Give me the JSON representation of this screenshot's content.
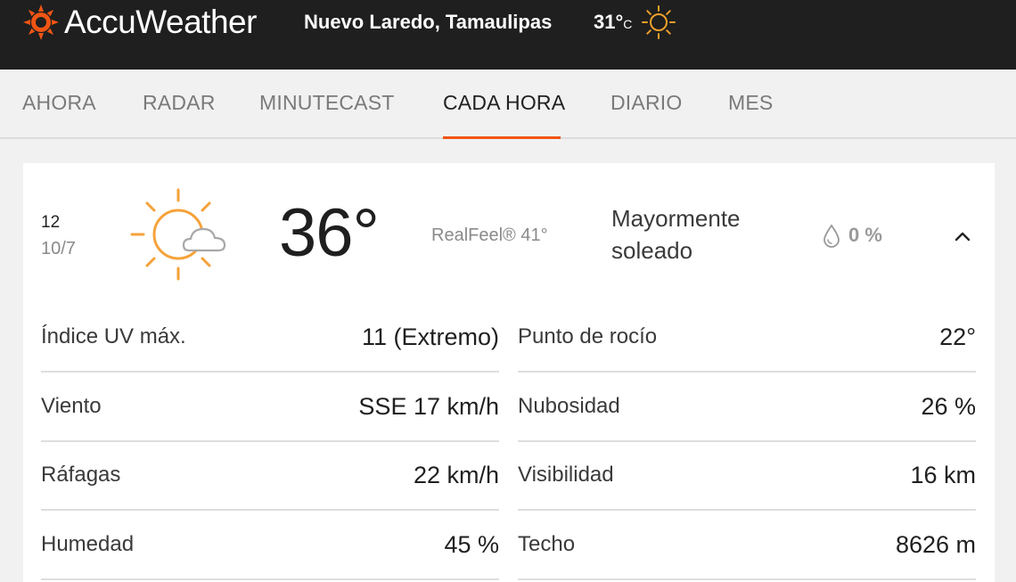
{
  "header": {
    "brand": "AccuWeather",
    "location": "Nuevo Laredo, Tamaulipas",
    "temp": "31°",
    "unit": "C",
    "logo_icon": "sun-logo-icon",
    "weather_icon": "sun-icon"
  },
  "nav": {
    "tabs": [
      "AHORA",
      "RADAR",
      "MINUTECAST",
      "CADA HORA",
      "DIARIO",
      "MES"
    ],
    "active_tab": "CADA HORA"
  },
  "hour_card": {
    "hour": "12",
    "date": "10/7",
    "icon": "mostly-sunny-icon",
    "temperature": "36°",
    "realfeel": "RealFeel® 41°",
    "phrase_line1": "Mayormente",
    "phrase_line2": "soleado",
    "precip_icon": "drop-icon",
    "precip": "0 %",
    "collapse_icon": "chevron-up-icon"
  },
  "details": {
    "left": [
      {
        "label": "Índice UV máx.",
        "value": "11 (Extremo)"
      },
      {
        "label": "Viento",
        "value": "SSE 17 km/h"
      },
      {
        "label": "Ráfagas",
        "value": "22 km/h"
      },
      {
        "label": "Humedad",
        "value": "45 %"
      }
    ],
    "right": [
      {
        "label": "Punto de rocío",
        "value": "22°"
      },
      {
        "label": "Nubosidad",
        "value": "26 %"
      },
      {
        "label": "Visibilidad",
        "value": "16 km"
      },
      {
        "label": "Techo",
        "value": "8626 m"
      }
    ]
  },
  "colors": {
    "accent": "#f05514",
    "header_bg": "#1f1f1f",
    "page_bg": "#f1f1f1"
  }
}
